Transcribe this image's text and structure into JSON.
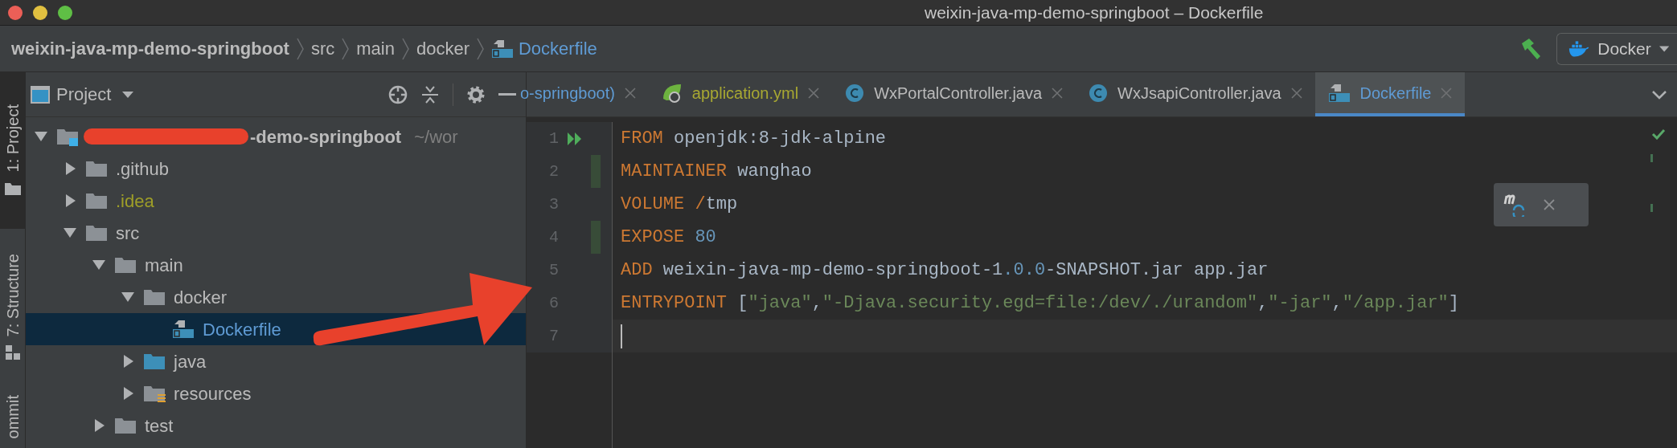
{
  "window": {
    "title": "weixin-java-mp-demo-springboot – Dockerfile"
  },
  "breadcrumbs": [
    {
      "label": "weixin-java-mp-demo-springboot",
      "kind": "project"
    },
    {
      "label": "src",
      "kind": "folder"
    },
    {
      "label": "main",
      "kind": "folder"
    },
    {
      "label": "docker",
      "kind": "folder"
    },
    {
      "label": "Dockerfile",
      "kind": "dockerfile"
    }
  ],
  "run_config": {
    "label": "Docker"
  },
  "tool_stripe": [
    {
      "label": "1: Project",
      "kind": "project",
      "selected": true
    },
    {
      "label": "7: Structure",
      "kind": "structure",
      "selected": false
    },
    {
      "label": "ommit",
      "kind": "commit",
      "selected": false
    }
  ],
  "project_panel": {
    "title": "Project",
    "tree": [
      {
        "label": "-demo-springboot",
        "hint": "~/wor",
        "kind": "project",
        "redacted": true,
        "expanded": true,
        "selected": false,
        "ignored": false,
        "children": [
          {
            "label": ".github",
            "kind": "folder",
            "expanded": false,
            "selected": false,
            "ignored": false
          },
          {
            "label": ".idea",
            "kind": "folder",
            "expanded": false,
            "selected": false,
            "ignored": true
          },
          {
            "label": "src",
            "kind": "folder",
            "expanded": true,
            "selected": false,
            "ignored": false,
            "children": [
              {
                "label": "main",
                "kind": "folder",
                "expanded": true,
                "selected": false,
                "ignored": false,
                "children": [
                  {
                    "label": "docker",
                    "kind": "folder",
                    "expanded": true,
                    "selected": false,
                    "ignored": false,
                    "children": [
                      {
                        "label": "Dockerfile",
                        "kind": "dockerfile",
                        "selected": true,
                        "ignored": false
                      }
                    ]
                  },
                  {
                    "label": "java",
                    "kind": "source",
                    "expanded": false,
                    "selected": false,
                    "ignored": false
                  },
                  {
                    "label": "resources",
                    "kind": "resources",
                    "expanded": false,
                    "selected": false,
                    "ignored": false
                  }
                ]
              },
              {
                "label": "test",
                "kind": "folder",
                "expanded": false,
                "selected": false,
                "ignored": false
              }
            ]
          }
        ]
      }
    ]
  },
  "tabs": [
    {
      "label": "o-springboot)",
      "kind": "plain",
      "selected": false
    },
    {
      "label": "application.yml",
      "kind": "spring",
      "selected": false
    },
    {
      "label": "WxPortalController.java",
      "kind": "class",
      "selected": false
    },
    {
      "label": "WxJsapiController.java",
      "kind": "class",
      "selected": false
    },
    {
      "label": "Dockerfile",
      "kind": "dockerfile",
      "selected": true
    }
  ],
  "editor": {
    "lines": [
      {
        "number": "1",
        "run": true,
        "changed": false,
        "current": false,
        "tokens": [
          {
            "kind": "keyword",
            "text": "FROM"
          },
          {
            "kind": "text",
            "text": " openjdk:8-jdk-alpine"
          }
        ]
      },
      {
        "number": "2",
        "run": false,
        "changed": true,
        "current": false,
        "tokens": [
          {
            "kind": "keyword",
            "text": "MAINTAINER"
          },
          {
            "kind": "text",
            "text": " wanghao"
          }
        ]
      },
      {
        "number": "3",
        "run": false,
        "changed": false,
        "current": false,
        "tokens": [
          {
            "kind": "keyword",
            "text": "VOLUME /"
          },
          {
            "kind": "text",
            "text": "tmp"
          }
        ]
      },
      {
        "number": "4",
        "run": false,
        "changed": true,
        "current": false,
        "tokens": [
          {
            "kind": "keyword",
            "text": "EXPOSE "
          },
          {
            "kind": "number",
            "text": "80"
          }
        ]
      },
      {
        "number": "5",
        "run": false,
        "changed": false,
        "current": false,
        "tokens": [
          {
            "kind": "keyword",
            "text": "ADD"
          },
          {
            "kind": "text",
            "text": " weixin-java-mp-demo-springboot-1"
          },
          {
            "kind": "number",
            "text": ".0.0"
          },
          {
            "kind": "text",
            "text": "-SNAPSHOT.jar app.jar"
          }
        ]
      },
      {
        "number": "6",
        "run": false,
        "changed": false,
        "current": false,
        "tokens": [
          {
            "kind": "keyword",
            "text": "ENTRYPOINT"
          },
          {
            "kind": "text",
            "text": " ["
          },
          {
            "kind": "string",
            "text": "\"java\""
          },
          {
            "kind": "text",
            "text": ","
          },
          {
            "kind": "string",
            "text": "\"-Djava.security.egd=file:/dev/./urandom\""
          },
          {
            "kind": "text",
            "text": ","
          },
          {
            "kind": "string",
            "text": "\"-jar\""
          },
          {
            "kind": "text",
            "text": ","
          },
          {
            "kind": "string",
            "text": "\"/app.jar\""
          },
          {
            "kind": "text",
            "text": "]"
          }
        ]
      },
      {
        "number": "7",
        "run": false,
        "changed": false,
        "current": true
      }
    ]
  }
}
